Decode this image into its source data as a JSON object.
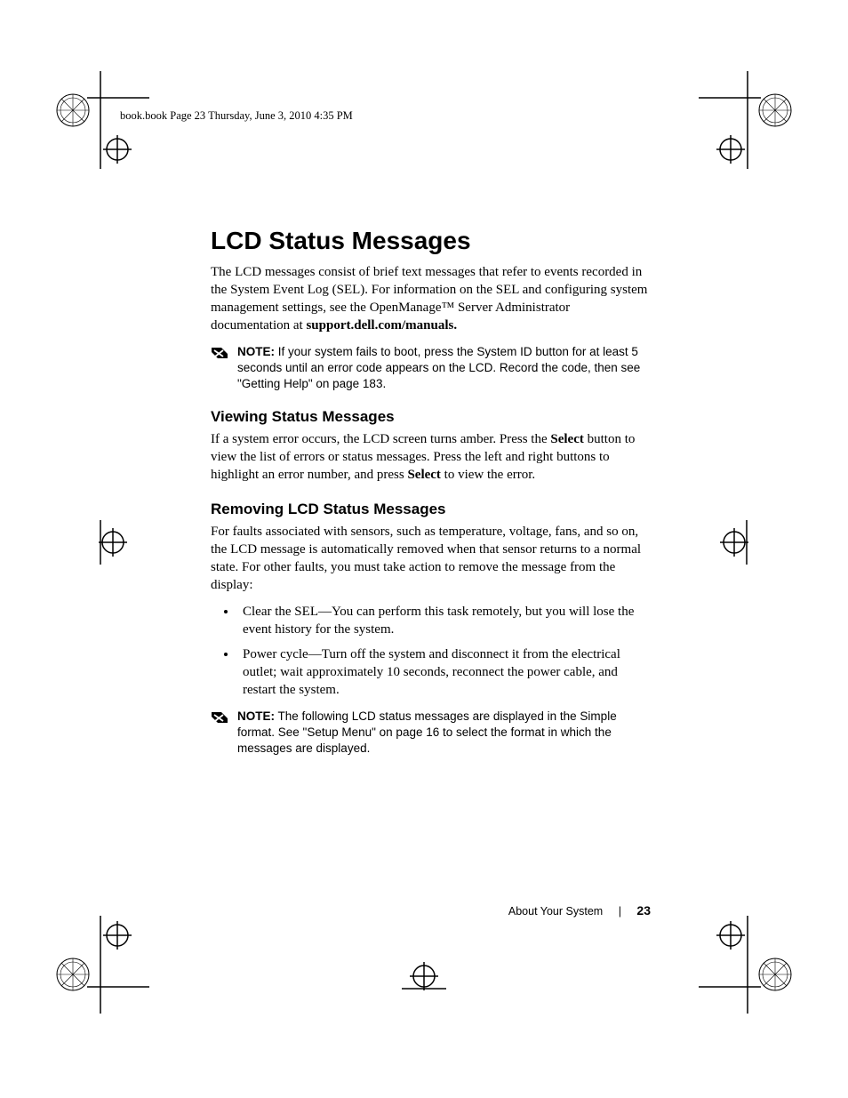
{
  "header": {
    "running": "book.book  Page 23  Thursday, June 3, 2010  4:35 PM"
  },
  "title": "LCD Status Messages",
  "intro": "The LCD messages consist of brief text messages that refer to events recorded in the System Event Log (SEL). For information on the SEL and configuring system management settings, see the OpenManage™ Server Administrator documentation at ",
  "intro_bold_tail": "support.dell.com/manuals.",
  "note1": {
    "label": "NOTE:",
    "text": " If your system fails to boot, press the System ID button for at least 5 seconds until an error code appears on the LCD. Record the code, then see \"Getting Help\" on page 183."
  },
  "sections": {
    "viewing": {
      "heading": "Viewing Status Messages",
      "p_pre": "If a system error occurs, the LCD screen turns amber. Press the ",
      "p_b1": "Select",
      "p_mid": " button to view the list of errors or status messages. Press the left and right buttons to highlight an error number, and press ",
      "p_b2": "Select",
      "p_post": " to view the error."
    },
    "removing": {
      "heading": "Removing LCD Status Messages",
      "p": "For faults associated with sensors, such as temperature, voltage, fans, and so on, the LCD message is automatically removed when that sensor returns to a normal state. For other faults, you must take action to remove the message from the display:",
      "bullets": [
        "Clear the SEL—You can perform this task remotely, but you will lose the event history for the system.",
        "Power cycle—Turn off the system and disconnect it from the electrical outlet; wait approximately 10 seconds, reconnect the power cable, and restart the system."
      ]
    }
  },
  "note2": {
    "label": "NOTE:",
    "text": " The following LCD status messages are displayed in the Simple format. See \"Setup Menu\" on page 16 to select the format in which the messages are displayed."
  },
  "footer": {
    "section": "About Your System",
    "page": "23"
  }
}
